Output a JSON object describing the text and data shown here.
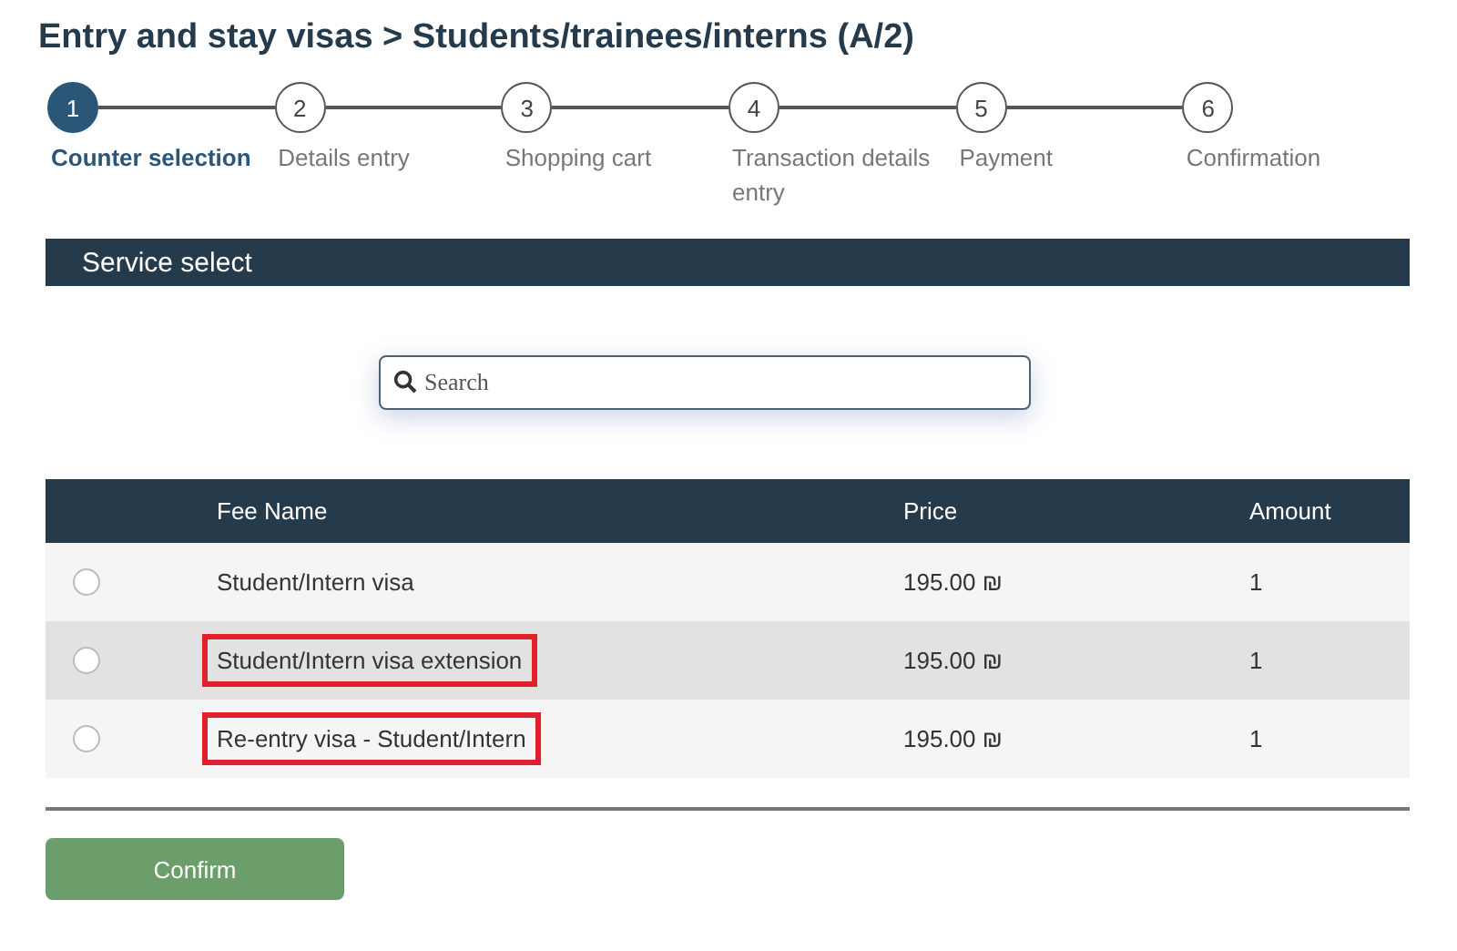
{
  "title": "Entry and stay visas > Students/trainees/interns (A/2)",
  "steps": [
    {
      "number": "1",
      "label": "Counter selection",
      "selected": true
    },
    {
      "number": "2",
      "label": "Details entry",
      "selected": false
    },
    {
      "number": "3",
      "label": "Shopping cart",
      "selected": false
    },
    {
      "number": "4",
      "label": "Transaction details entry",
      "selected": false
    },
    {
      "number": "5",
      "label": "Payment",
      "selected": false
    },
    {
      "number": "6",
      "label": "Confirmation",
      "selected": false
    }
  ],
  "section_title": "Service select",
  "search": {
    "placeholder": "Search"
  },
  "table": {
    "columns": [
      "Fee Name",
      "Price",
      "Amount"
    ],
    "rows": [
      {
        "fee_name": "Student/Intern visa",
        "price": "195.00 ₪",
        "amount": "1",
        "selected": false,
        "hovered": false,
        "highlighted": false
      },
      {
        "fee_name": "Student/Intern visa extension",
        "price": "195.00 ₪",
        "amount": "1",
        "selected": false,
        "hovered": true,
        "highlighted": true
      },
      {
        "fee_name": "Re-entry visa - Student/Intern",
        "price": "195.00 ₪",
        "amount": "1",
        "selected": false,
        "hovered": false,
        "highlighted": true
      }
    ]
  },
  "confirm_button": "Confirm"
}
